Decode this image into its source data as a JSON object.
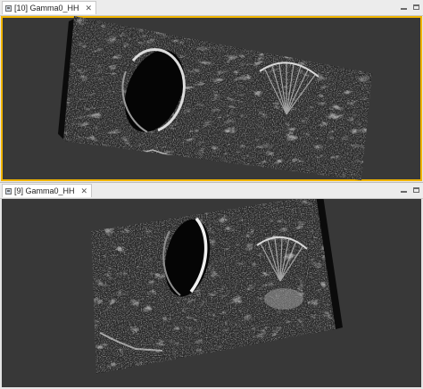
{
  "views": [
    {
      "tab_title": "[10] Gamma0_HH",
      "active": true
    },
    {
      "tab_title": "[9] Gamma0_HH",
      "active": false
    }
  ],
  "icons": {
    "tab_icon": "image-view-icon",
    "close": "close-icon",
    "minimize": "minimize-icon",
    "maximize": "maximize-icon"
  },
  "colors": {
    "canvas_background": "#383838",
    "active_view_border": "#f0b400",
    "tab_background": "#ffffff"
  }
}
